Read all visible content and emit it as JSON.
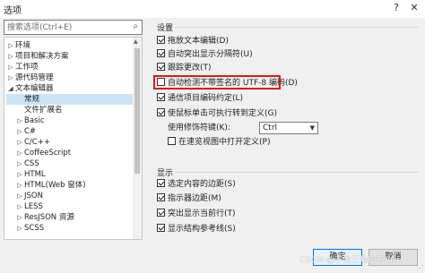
{
  "window": {
    "title": "选项",
    "help": "?",
    "close": "✕"
  },
  "search": {
    "placeholder": "搜索选项(Ctrl+E)"
  },
  "tree": [
    {
      "label": "环境",
      "arrow": "▷"
    },
    {
      "label": "项目和解决方案",
      "arrow": "▷"
    },
    {
      "label": "工作项",
      "arrow": "▷"
    },
    {
      "label": "源代码管理",
      "arrow": "▷"
    },
    {
      "label": "文本编辑器",
      "arrow": "◢"
    },
    {
      "label": "常规",
      "arrow": "",
      "selected": true
    },
    {
      "label": "文件扩展名",
      "arrow": ""
    },
    {
      "label": "Basic",
      "arrow": "▷"
    },
    {
      "label": "C#",
      "arrow": "▷"
    },
    {
      "label": "C/C++",
      "arrow": "▷"
    },
    {
      "label": "CoffeeScript",
      "arrow": "▷"
    },
    {
      "label": "CSS",
      "arrow": "▷"
    },
    {
      "label": "HTML",
      "arrow": "▷"
    },
    {
      "label": "HTML(Web 窗体)",
      "arrow": "▷"
    },
    {
      "label": "JSON",
      "arrow": "▷"
    },
    {
      "label": "LESS",
      "arrow": "▷"
    },
    {
      "label": "ResJSON 资源",
      "arrow": "▷"
    },
    {
      "label": "SCSS",
      "arrow": "▷"
    }
  ],
  "settings": {
    "title": "设置",
    "options": [
      {
        "label": "拖放文本编辑(D)",
        "checked": true
      },
      {
        "label": "自动突出显示分隔符(U)",
        "checked": true
      },
      {
        "label": "跟踪更改(T)",
        "checked": true
      },
      {
        "label": "自动检测不带签名的 UTF-8 编码(D)",
        "checked": false
      },
      {
        "label": "通信项目编码约定(L)",
        "checked": true
      },
      {
        "label": "使鼠标单击可执行转到定义(G)",
        "checked": true
      }
    ],
    "modifier_label": "使用修饰符键(K):",
    "modifier_value": "Ctrl",
    "peek_label": "在速览视图中打开定义(P)",
    "peek_checked": false
  },
  "display": {
    "title": "显示",
    "options": [
      {
        "label": "选定内容的边距(S)",
        "checked": true
      },
      {
        "label": "指示器边距(M)",
        "checked": true
      },
      {
        "label": "突出显示当前行(T)",
        "checked": true
      },
      {
        "label": "显示结构参考线(S)",
        "checked": true
      }
    ]
  },
  "buttons": {
    "ok": "确定",
    "cancel": "取消"
  },
  "watermark": "CSDN @不会三角的猫08",
  "colors": {
    "highlight": "#e01818",
    "selection": "#cce4f7",
    "ok_border": "#0078d7"
  }
}
